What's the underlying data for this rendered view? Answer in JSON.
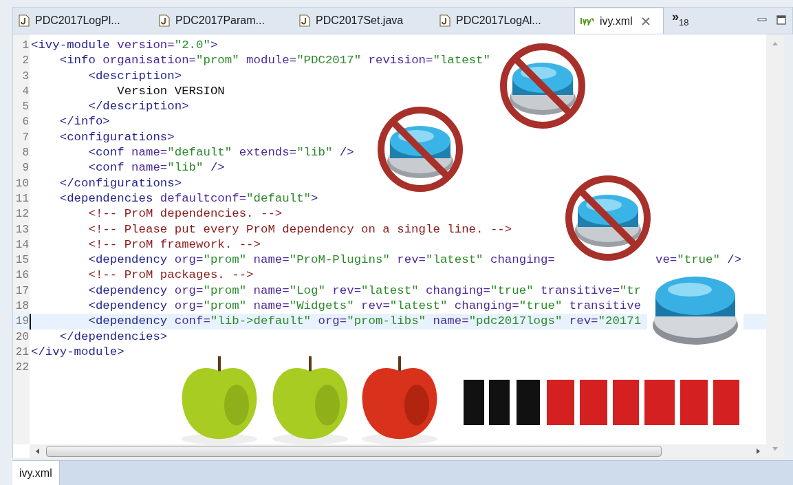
{
  "tabs": [
    {
      "label": "PDC2017LogPl...",
      "kind": "java",
      "selected": false
    },
    {
      "label": "PDC2017Param...",
      "kind": "java",
      "selected": false
    },
    {
      "label": "PDC2017Set.java",
      "kind": "java",
      "selected": false
    },
    {
      "label": "PDC2017LogAl...",
      "kind": "java",
      "selected": false
    },
    {
      "label": "ivy.xml",
      "kind": "ivy",
      "selected": true
    }
  ],
  "overflow": {
    "glyph": "»",
    "count": "18"
  },
  "editor": {
    "lines": [
      {
        "number": "1",
        "current": false,
        "tokens": [
          {
            "kind": "tag",
            "text": "<ivy-module"
          },
          {
            "kind": "attr",
            "text": " version="
          },
          {
            "kind": "value",
            "text": "\"2.0\""
          },
          {
            "kind": "tag",
            "text": ">"
          }
        ]
      },
      {
        "number": "2",
        "current": false,
        "tokens": [
          {
            "kind": "tag",
            "text": "    <info"
          },
          {
            "kind": "attr",
            "text": " organisation="
          },
          {
            "kind": "value",
            "text": "\"prom\""
          },
          {
            "kind": "attr",
            "text": " module="
          },
          {
            "kind": "value",
            "text": "\"PDC2017\""
          },
          {
            "kind": "attr",
            "text": " revision="
          },
          {
            "kind": "value",
            "text": "\"latest\""
          }
        ]
      },
      {
        "number": "3",
        "current": false,
        "tokens": [
          {
            "kind": "tag",
            "text": "        <description>"
          }
        ]
      },
      {
        "number": "4",
        "current": false,
        "tokens": [
          {
            "kind": "text",
            "text": "            Version VERSION"
          }
        ]
      },
      {
        "number": "5",
        "current": false,
        "tokens": [
          {
            "kind": "tag",
            "text": "        </description>"
          }
        ]
      },
      {
        "number": "6",
        "current": false,
        "tokens": [
          {
            "kind": "tag",
            "text": "    </info>"
          }
        ]
      },
      {
        "number": "7",
        "current": false,
        "tokens": [
          {
            "kind": "tag",
            "text": "    <configurations>"
          }
        ]
      },
      {
        "number": "8",
        "current": false,
        "tokens": [
          {
            "kind": "tag",
            "text": "        <conf"
          },
          {
            "kind": "attr",
            "text": " name="
          },
          {
            "kind": "value",
            "text": "\"default\""
          },
          {
            "kind": "attr",
            "text": " extends="
          },
          {
            "kind": "value",
            "text": "\"lib\""
          },
          {
            "kind": "tag",
            "text": " />"
          }
        ]
      },
      {
        "number": "9",
        "current": false,
        "tokens": [
          {
            "kind": "tag",
            "text": "        <conf"
          },
          {
            "kind": "attr",
            "text": " name="
          },
          {
            "kind": "value",
            "text": "\"lib\""
          },
          {
            "kind": "tag",
            "text": " />"
          }
        ]
      },
      {
        "number": "10",
        "current": false,
        "tokens": [
          {
            "kind": "tag",
            "text": "    </configurations>"
          }
        ]
      },
      {
        "number": "11",
        "current": false,
        "tokens": [
          {
            "kind": "tag",
            "text": "    <dependencies"
          },
          {
            "kind": "attr",
            "text": " defaultconf="
          },
          {
            "kind": "value",
            "text": "\"default\""
          },
          {
            "kind": "tag",
            "text": ">"
          }
        ]
      },
      {
        "number": "12",
        "current": false,
        "tokens": [
          {
            "kind": "comment",
            "text": "        <!-- ProM dependencies. -->"
          }
        ]
      },
      {
        "number": "13",
        "current": false,
        "tokens": [
          {
            "kind": "comment",
            "text": "        <!-- Please put every ProM dependency on a single line. -->"
          }
        ]
      },
      {
        "number": "14",
        "current": false,
        "tokens": [
          {
            "kind": "comment",
            "text": "        <!-- ProM framework. -->"
          }
        ]
      },
      {
        "number": "15",
        "current": false,
        "tokens": [
          {
            "kind": "tag",
            "text": "        <dependency"
          },
          {
            "kind": "attr",
            "text": " org="
          },
          {
            "kind": "value",
            "text": "\"prom\""
          },
          {
            "kind": "attr",
            "text": " name="
          },
          {
            "kind": "value",
            "text": "\"ProM-Plugins\""
          },
          {
            "kind": "attr",
            "text": " rev="
          },
          {
            "kind": "value",
            "text": "\"latest\""
          },
          {
            "kind": "attr",
            "text": " changing="
          }
        ],
        "tail": [
          {
            "kind": "attr",
            "text": "ve="
          },
          {
            "kind": "value",
            "text": "\"true\""
          },
          {
            "kind": "tag",
            "text": " />"
          }
        ]
      },
      {
        "number": "16",
        "current": false,
        "tokens": [
          {
            "kind": "comment",
            "text": "        <!-- ProM packages. -->"
          }
        ]
      },
      {
        "number": "17",
        "current": false,
        "tokens": [
          {
            "kind": "tag",
            "text": "        <dependency"
          },
          {
            "kind": "attr",
            "text": " org="
          },
          {
            "kind": "value",
            "text": "\"prom\""
          },
          {
            "kind": "attr",
            "text": " name="
          },
          {
            "kind": "value",
            "text": "\"Log\""
          },
          {
            "kind": "attr",
            "text": " rev="
          },
          {
            "kind": "value",
            "text": "\"latest\""
          },
          {
            "kind": "attr",
            "text": " changing="
          },
          {
            "kind": "value",
            "text": "\"true\""
          },
          {
            "kind": "attr",
            "text": " transitive="
          },
          {
            "kind": "value",
            "text": "\"tr"
          }
        ]
      },
      {
        "number": "18",
        "current": false,
        "tokens": [
          {
            "kind": "tag",
            "text": "        <dependency"
          },
          {
            "kind": "attr",
            "text": " org="
          },
          {
            "kind": "value",
            "text": "\"prom\""
          },
          {
            "kind": "attr",
            "text": " name="
          },
          {
            "kind": "value",
            "text": "\"Widgets\""
          },
          {
            "kind": "attr",
            "text": " rev="
          },
          {
            "kind": "value",
            "text": "\"latest\""
          },
          {
            "kind": "attr",
            "text": " changing="
          },
          {
            "kind": "value",
            "text": "\"true\""
          },
          {
            "kind": "attr",
            "text": " transitive"
          }
        ]
      },
      {
        "number": "19",
        "current": true,
        "tokens": [
          {
            "kind": "tag",
            "text": "        <dependency"
          },
          {
            "kind": "attr",
            "text": " conf="
          },
          {
            "kind": "value",
            "text": "\"lib->default\""
          },
          {
            "kind": "attr",
            "text": " org="
          },
          {
            "kind": "value",
            "text": "\"prom-libs\""
          },
          {
            "kind": "attr",
            "text": " name="
          },
          {
            "kind": "value",
            "text": "\"pdc2017logs\""
          },
          {
            "kind": "attr",
            "text": " rev="
          },
          {
            "kind": "value",
            "text": "\"20171"
          }
        ]
      },
      {
        "number": "20",
        "current": false,
        "tokens": [
          {
            "kind": "tag",
            "text": "    </dependencies>"
          }
        ]
      },
      {
        "number": "21",
        "current": false,
        "tokens": [
          {
            "kind": "tag",
            "text": "</ivy-module>"
          }
        ]
      },
      {
        "number": "22",
        "current": false
      }
    ]
  },
  "bottom_tabs": [
    {
      "label": "ivy.xml",
      "selected": true
    }
  ]
}
